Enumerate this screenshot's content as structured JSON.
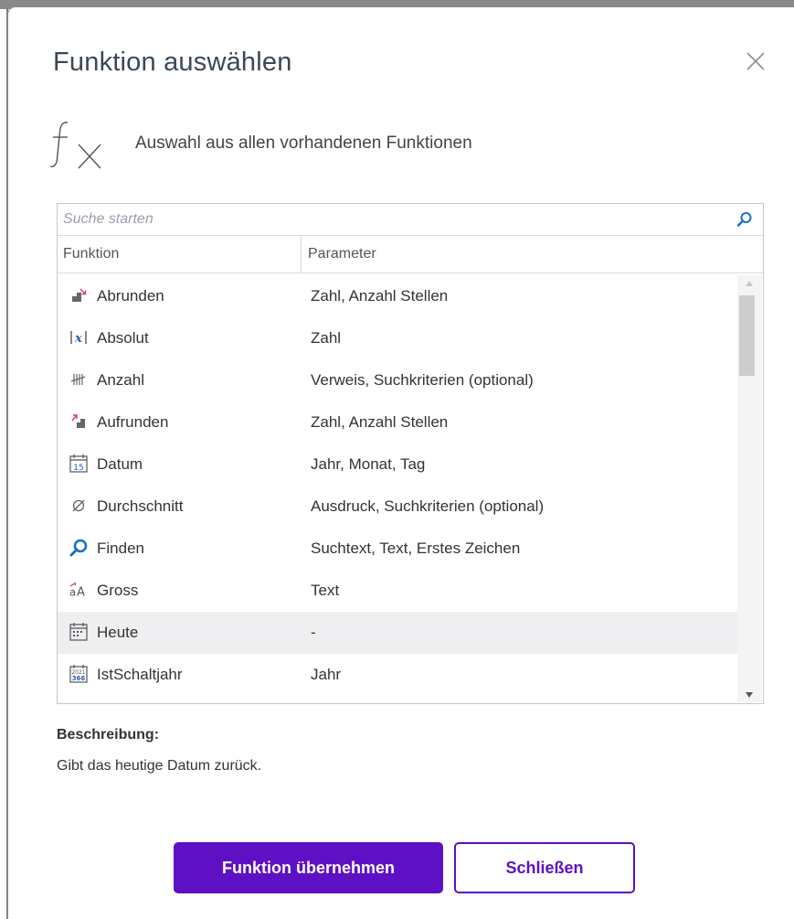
{
  "dialog": {
    "title": "Funktion auswählen",
    "subtitle": "Auswahl aus allen vorhandenen Funktionen"
  },
  "search": {
    "placeholder": "Suche starten",
    "value": ""
  },
  "table": {
    "columns": [
      "Funktion",
      "Parameter"
    ],
    "rows": [
      {
        "name": "Abrunden",
        "params": "Zahl, Anzahl Stellen",
        "icon": "round-down-icon"
      },
      {
        "name": "Absolut",
        "params": "Zahl",
        "icon": "absolute-value-icon"
      },
      {
        "name": "Anzahl",
        "params": "Verweis, Suchkriterien (optional)",
        "icon": "tally-count-icon"
      },
      {
        "name": "Aufrunden",
        "params": "Zahl, Anzahl Stellen",
        "icon": "round-up-icon"
      },
      {
        "name": "Datum",
        "params": "Jahr, Monat, Tag",
        "icon": "calendar-date-icon"
      },
      {
        "name": "Durchschnitt",
        "params": "Ausdruck, Suchkriterien (optional)",
        "icon": "average-icon"
      },
      {
        "name": "Finden",
        "params": "Suchtext, Text, Erstes Zeichen",
        "icon": "find-search-icon"
      },
      {
        "name": "Gross",
        "params": "Text",
        "icon": "uppercase-icon"
      },
      {
        "name": "Heute",
        "params": "-",
        "icon": "calendar-today-icon",
        "selected": true
      },
      {
        "name": "IstSchaltjahr",
        "params": "Jahr",
        "icon": "leap-year-calendar-icon"
      }
    ]
  },
  "description": {
    "label": "Beschreibung:",
    "text": "Gibt das heutige Datum zurück."
  },
  "buttons": {
    "apply": "Funktion übernehmen",
    "close": "Schließen"
  },
  "colors": {
    "accent": "#5e10c4",
    "title": "#3c4756",
    "search_icon": "#1a6fc9",
    "selected_row": "#efeff1"
  }
}
